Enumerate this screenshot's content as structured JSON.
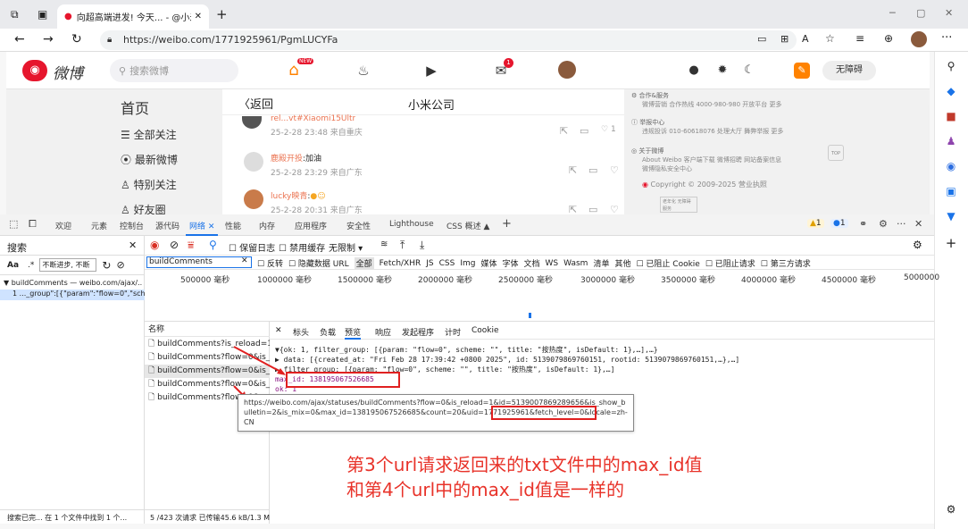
{
  "browser": {
    "tab_title": "向超高端进发! 今天... - @小米公",
    "url": "https://weibo.com/1771925961/PgmLUCYFa"
  },
  "weibo": {
    "logo": "微博",
    "search_placeholder": "搜索微博",
    "new_badge": "NEW",
    "mail_badge": "1",
    "accessibility": "无障碍",
    "nav": [
      "首页",
      "全部关注",
      "最新微博",
      "特别关注",
      "好友圈"
    ],
    "back": "返回",
    "page_title": "小米公司",
    "posts": [
      {
        "name": "rel...vt#Xiaomi15Ultr",
        "text": "...换着小米...",
        "meta": "25-2-28 23:48 来自重庆",
        "likes": "1"
      },
      {
        "name": "鹿殿开投",
        "text": ":加油",
        "meta": "25-2-28 23:29 来自广东",
        "likes": ""
      },
      {
        "name": "lucky映青",
        "text": ":",
        "meta": "25-2-28 20:31 来自广东",
        "likes": ""
      }
    ],
    "right": [
      {
        "head": "合作&服务",
        "line": "微博营销   合作热线 4000-980-980   开放平台   更多"
      },
      {
        "head": "举报中心",
        "line": "违规投诉 010-60618076   处理大厅   舞弊举报   更多"
      },
      {
        "head": "关于微博",
        "line": "About Weibo   客户端下载   微博招聘   网站备案信息"
      },
      {
        "head": "",
        "line": "微博隐私安全中心"
      }
    ],
    "copyright": "Copyright © 2009-2025 营业执照",
    "top_label": "TOP",
    "elder_label": "老年化 无障碍服务"
  },
  "devtools": {
    "tabs": [
      "欢迎",
      "元素",
      "控制台",
      "源代码",
      "网络",
      "性能",
      "内存",
      "应用程序",
      "安全性",
      "Lighthouse",
      "CSS 概述"
    ],
    "active_tab": "网络",
    "warn_count": "1",
    "err_count": "1",
    "search_label": "搜索",
    "search_case": "Aa",
    "search_regex": ".*",
    "search_input": "不断进步, 不断",
    "search_group": "buildComments — weibo.com/ajax/...",
    "search_match": "1   ..._group\":[{\"param\":\"flow=0\",\"sche...",
    "search_status": "搜索已完... 在 1 个文件中找到 1 个...",
    "net_opts": [
      "保留日志",
      "禁用缓存",
      "无限制"
    ],
    "filter_value": "buildComments",
    "filter_types": [
      "反转",
      "隐藏数据 URL",
      "全部",
      "Fetch/XHR",
      "JS",
      "CSS",
      "Img",
      "媒体",
      "字体",
      "文档",
      "WS",
      "Wasm",
      "清单",
      "其他",
      "已阻止 Cookie",
      "已阻止请求",
      "第三方请求"
    ],
    "ticks": [
      "500000 毫秒",
      "1000000 毫秒",
      "1500000 毫秒",
      "2000000 毫秒",
      "2500000 毫秒",
      "3000000 毫秒",
      "3500000 毫秒",
      "4000000 毫秒",
      "4500000 毫秒",
      "5000000"
    ],
    "name_header": "名称",
    "requests": [
      "buildComments?is_reload=1&...",
      "buildComments?flow=0&is_re...",
      "buildComments?flow=0&is_re...",
      "buildComments?flow=0&is_re...",
      "buildComments?flow=0&..."
    ],
    "footer": "5 /423 次请求  已传输45.6 kB/1.3 M",
    "detail_tabs": [
      "标头",
      "负载",
      "预览",
      "响应",
      "发起程序",
      "计时",
      "Cookie"
    ],
    "active_detail": "预览",
    "preview": [
      "▼{ok: 1, filter_group: [{param: \"flow=0\", scheme: \"\", title: \"按热度\", isDefault: 1},…],…}",
      "  ▶ data: [{created_at: \"Fri Feb 28 17:39:42 +0800 2025\", id: 5139079869760151, rootid: 5139079869760151,…},…]",
      "  ▶ filter_group: [{param: \"flow=0\", scheme: \"\", title: \"按热度\", isDefault: 1},…]",
      "    max_id: 138195067526685",
      "    ok: 1"
    ],
    "tooltip": "https://weibo.com/ajax/statuses/buildComments?flow=0&is_reload=1&id=5139007869289656&is_show_bulletin=2&is_mix=0&max_id=138195067526685&count=20&uid=1771925961&fetch_level=0&locale=zh-CN"
  },
  "annotation": [
    "第3个url请求返回来的txt文件中的max_id值",
    "和第4个url中的max_id值是一样的"
  ],
  "colors": {
    "weibo_orange": "#ff8200",
    "annotation_red": "#e8332a",
    "devtools_blue": "#1a73e8"
  }
}
